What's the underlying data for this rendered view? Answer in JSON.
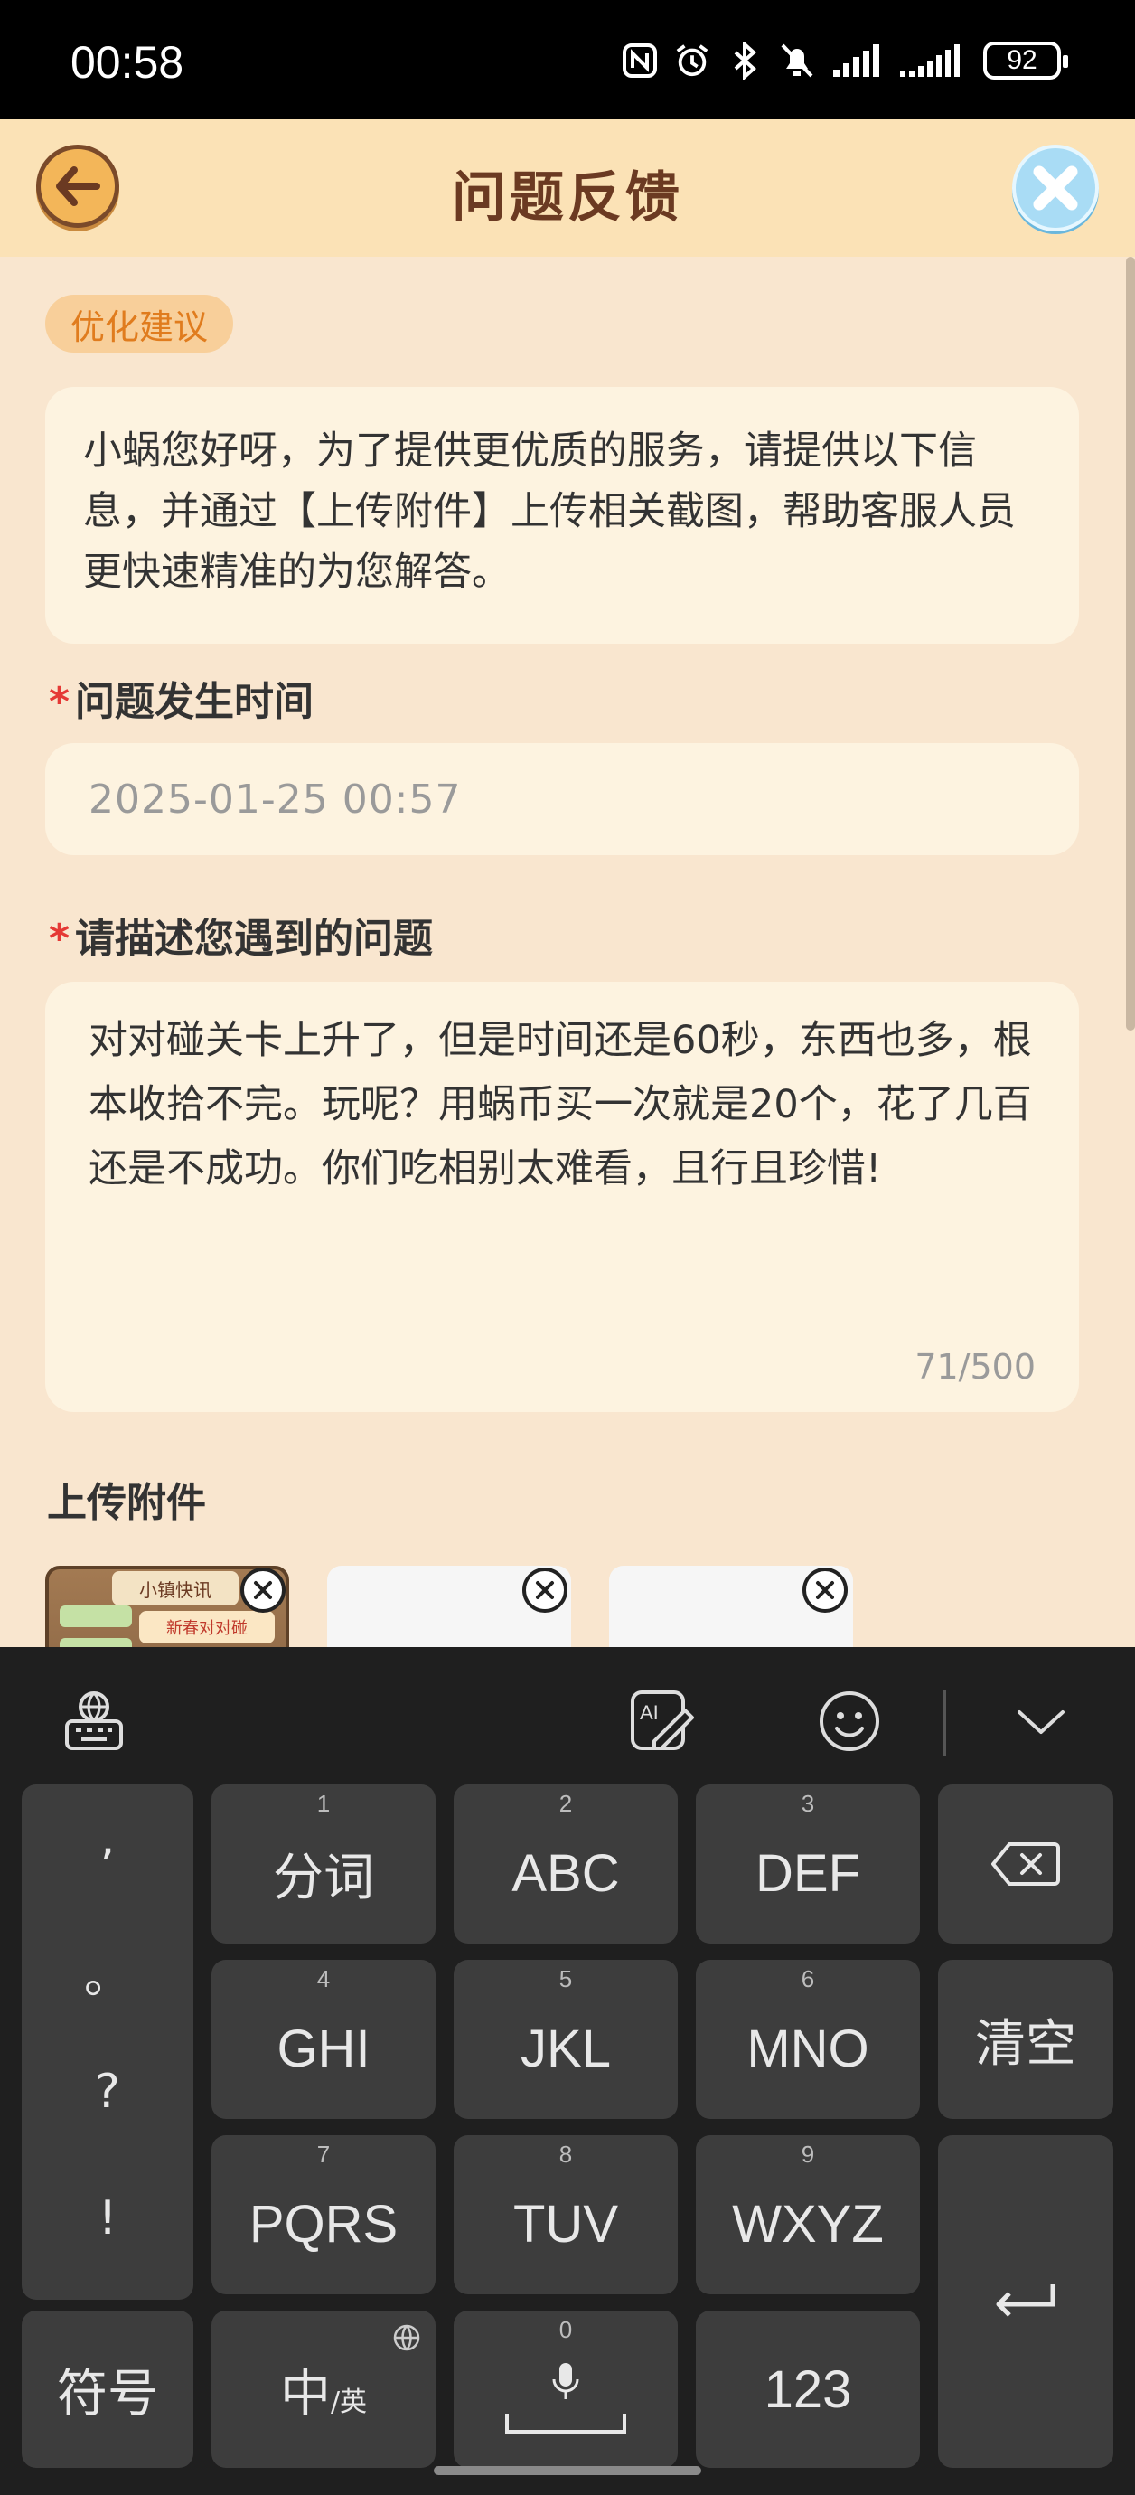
{
  "status_bar": {
    "time": "00:58",
    "battery": "92"
  },
  "header": {
    "title": "问题反馈"
  },
  "form": {
    "category_tag": "优化建议",
    "notice": "小蜗您好呀，为了提供更优质的服务，请提供以下信息，并通过【上传附件】上传相关截图，帮助客服人员更快速精准的为您解答。",
    "time_label": "问题发生时间",
    "time_value": "2025-01-25 00:57",
    "desc_label": "请描述您遇到的问题",
    "desc_value": "对对碰关卡上升了，但是时间还是60秒，东西也多，根本收拾不完。玩呢？用蜗币买一次就是20个，花了几百还是不成功。你们吃相别太难看，且行且珍惜!",
    "desc_counter": "71/500",
    "upload_label": "上传附件",
    "thumb_banner": "小镇快讯",
    "thumb_card": "新春对对碰",
    "required_mark": "*"
  },
  "keyboard": {
    "punct": [
      ",",
      "。",
      "?",
      "!"
    ],
    "keys": [
      {
        "num": "1",
        "label": "分词"
      },
      {
        "num": "2",
        "label": "ABC"
      },
      {
        "num": "3",
        "label": "DEF"
      },
      {
        "num": "4",
        "label": "GHI"
      },
      {
        "num": "5",
        "label": "JKL"
      },
      {
        "num": "6",
        "label": "MNO"
      },
      {
        "num": "7",
        "label": "PQRS"
      },
      {
        "num": "8",
        "label": "TUV"
      },
      {
        "num": "9",
        "label": "WXYZ"
      }
    ],
    "clear": "清空",
    "symbols": "符号",
    "lang_main": "中",
    "lang_sub": "/英",
    "space_num": "0",
    "numbers": "123"
  }
}
